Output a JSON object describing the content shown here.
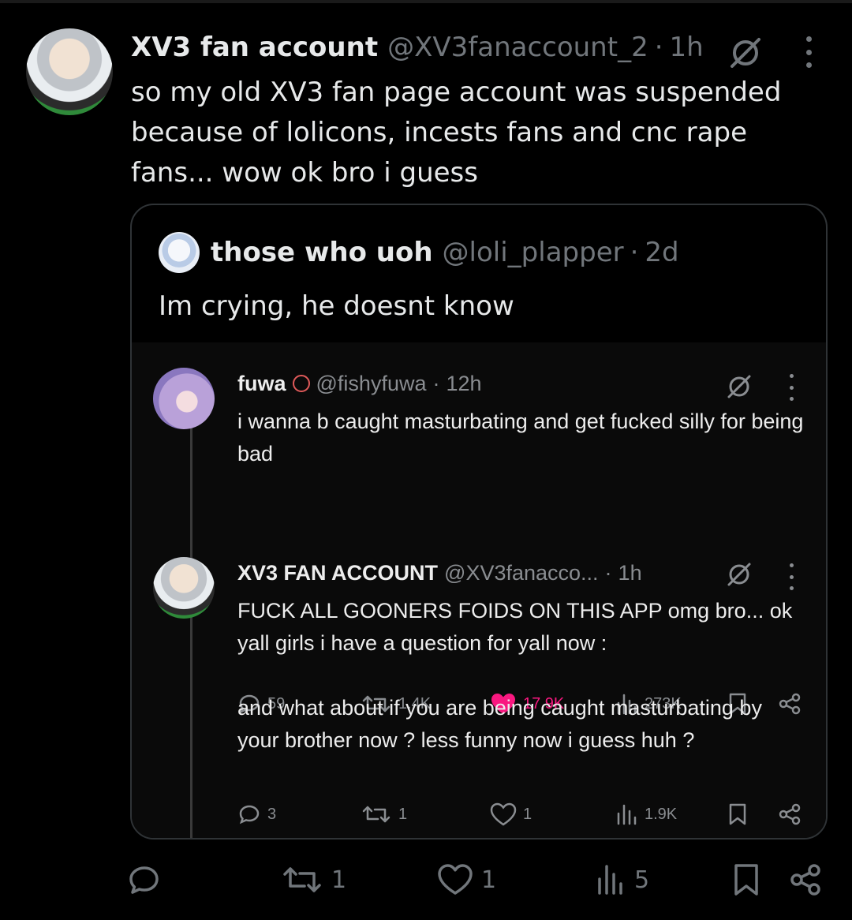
{
  "tweet": {
    "display_name": "XV3 fan account",
    "handle": "@XV3fanaccount_2",
    "separator": "·",
    "time": "1h",
    "text": "so my old XV3 fan page account was suspended because of lolicons, incests fans and cnc rape fans... wow ok bro i guess",
    "avatar_icon": "anime-avatar-icon",
    "actions": {
      "retweets": "1",
      "likes": "1",
      "views": "5"
    }
  },
  "quote": {
    "display_name": "those who uoh",
    "handle": "@loli_plapper",
    "separator": "·",
    "time": "2d",
    "text": "Im crying, he doesnt know",
    "embedded": [
      {
        "display_name": "fuwa",
        "handle": "@fishyfuwa",
        "separator": "·",
        "time": "12h",
        "text": "i wanna b caught masturbating and get fucked silly for being bad",
        "replies": "59",
        "retweets": "1.4K",
        "likes": "17.9K",
        "views": "273K",
        "liked": true
      },
      {
        "display_name": "XV3 FAN ACCOUNT",
        "handle": "@XV3fanacco...",
        "separator": "·",
        "time": "1h",
        "text": "FUCK ALL GOONERS FOIDS ON THIS APP omg bro... ok yall girls i have a question for yall now :\n\nand what about if you are being caught masturbating by your brother now ? less funny now i guess huh ?",
        "replies": "3",
        "retweets": "1",
        "likes": "1",
        "views": "1.9K",
        "liked": false
      }
    ]
  },
  "colors": {
    "background": "#000000",
    "text_primary": "#e7e9ea",
    "text_secondary": "#71767b",
    "border": "#2f3336",
    "like_active": "#f91880"
  }
}
